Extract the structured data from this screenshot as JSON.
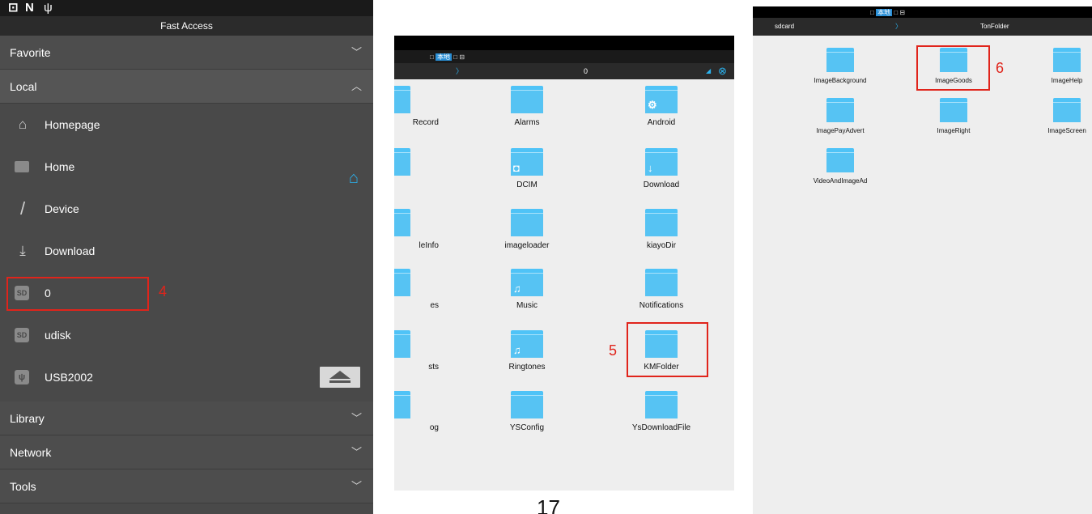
{
  "panel1": {
    "title": "Fast Access",
    "sections": {
      "favorite": "Favorite",
      "local": "Local",
      "library": "Library",
      "network": "Network",
      "tools": "Tools"
    },
    "local_items": {
      "homepage": "Homepage",
      "home": "Home",
      "device": "Device",
      "download": "Download",
      "sd0": "0",
      "udisk": "udisk",
      "usb": "USB2002"
    },
    "sd_badge": "SD",
    "step_label": "4"
  },
  "panel2": {
    "path_current": "0",
    "folders": {
      "c0r0": "Record",
      "c1r0": "Alarms",
      "c2r0": "Android",
      "c1r1": "DCIM",
      "c2r1": "Download",
      "c0r2": "leInfo",
      "c1r2": "imageloader",
      "c2r2": "kiayoDir",
      "c0r3": "es",
      "c1r3": "Music",
      "c2r3": "Notifications",
      "c0r4": "sts",
      "c1r4": "Ringtones",
      "c2r4": "KMFolder",
      "c0r5": "og",
      "c1r5": "YSConfig",
      "c2r5": "YsDownloadFile"
    },
    "step_label": "5",
    "page_number": "17"
  },
  "panel3": {
    "path_left": "sdcard",
    "path_current": "TonFolder",
    "folders": {
      "a": "ImageBackground",
      "b": "ImageGoods",
      "c": "ImageHelp",
      "d": "ImagePayAdvert",
      "e": "ImageRight",
      "f": "ImageScreen",
      "g": "VideoAndImageAd"
    },
    "step_label": "6"
  },
  "tinytab_local": "本地",
  "colors": {
    "drawer_bg": "#494949",
    "accent_blue": "#2ab3f0",
    "folder_blue": "#56c3f3",
    "highlight_red": "#e0241b"
  }
}
